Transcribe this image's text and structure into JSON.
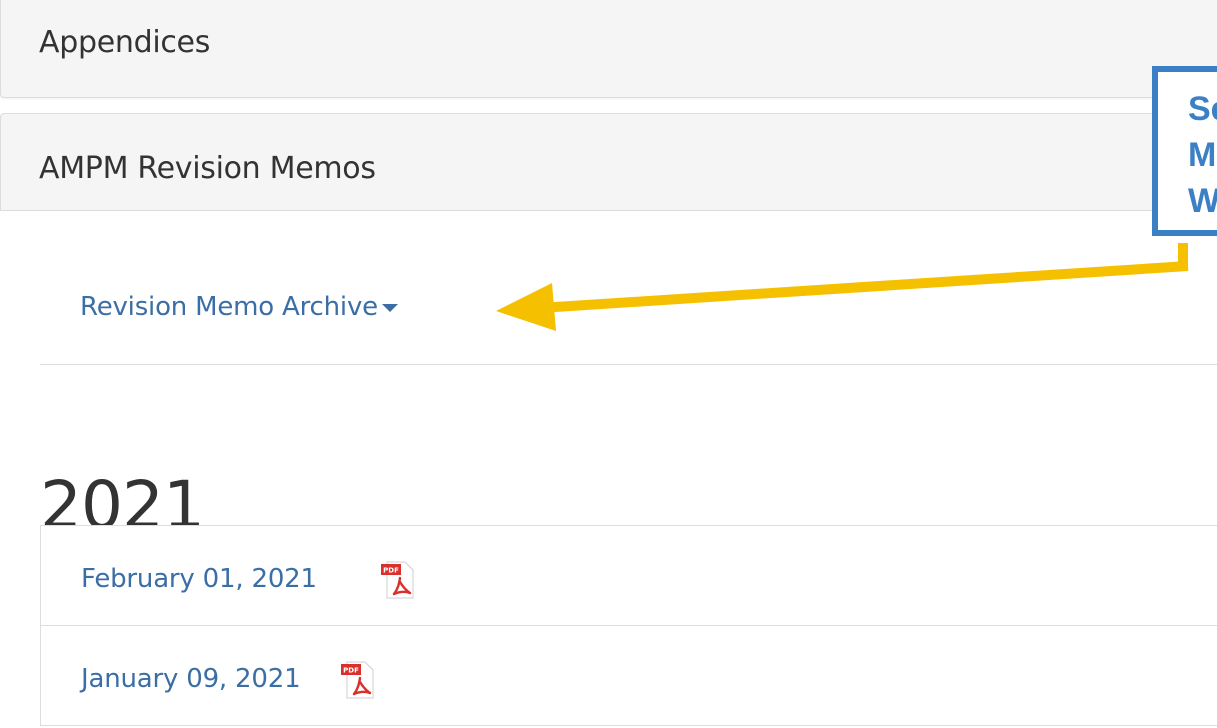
{
  "panels": {
    "appendices_title": "Appendices",
    "ampm_title": "AMPM Revision Memos"
  },
  "archive": {
    "link_label": "Revision Memo Archive"
  },
  "year_section": {
    "year": "2021",
    "memos": [
      {
        "date": "February 01, 2021",
        "icon": "pdf-icon"
      },
      {
        "date": "January 09, 2021",
        "icon": "pdf-icon"
      }
    ]
  },
  "callout": {
    "lines": [
      "Select t",
      "Memo",
      "Wish to"
    ],
    "border_color": "#3b7fc4",
    "text_color": "#3b7fc4"
  },
  "arrow": {
    "color": "#f5c000"
  },
  "colors": {
    "link": "#3b6ea5",
    "text": "#333333",
    "pdf_red": "#d9302c"
  }
}
